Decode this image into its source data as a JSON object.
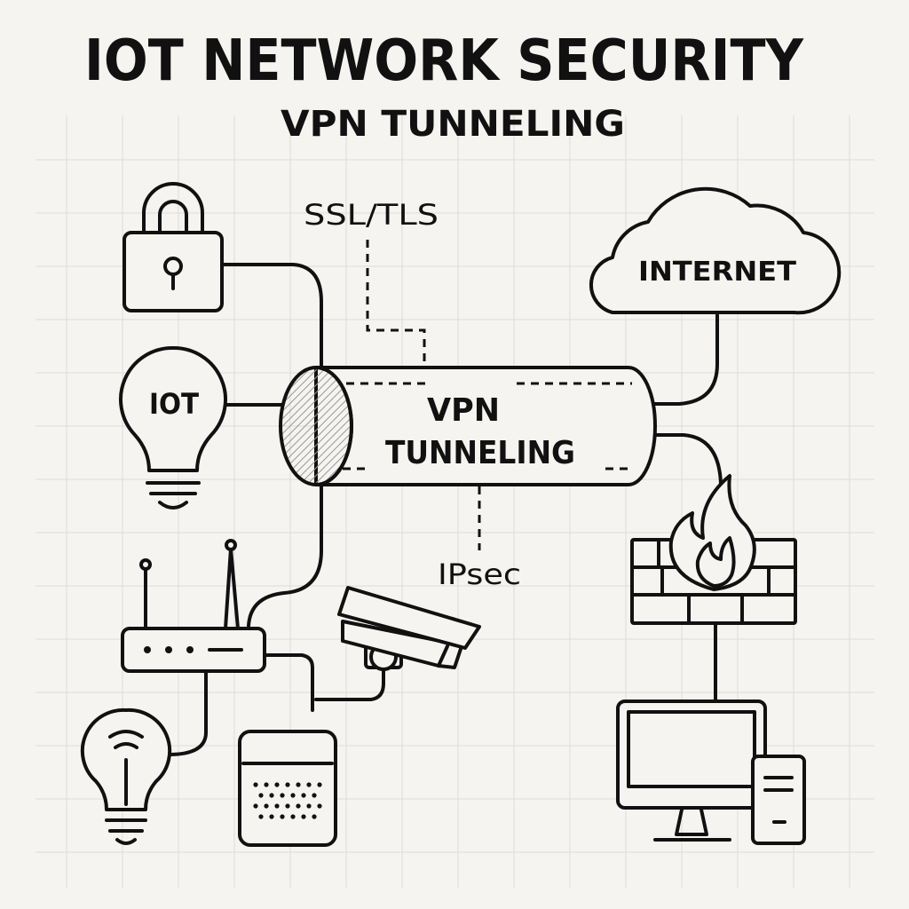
{
  "title": "IOT NETWORK SECURITY",
  "subtitle": "VPN TUNNELING",
  "labels": {
    "ssl_tls": "SSL/TLS",
    "internet": "INTERNET",
    "iot_bulb": "IOT",
    "tunnel_line1": "VPN",
    "tunnel_line2": "TUNNELING",
    "ipsec": "IPsec"
  },
  "colors": {
    "ink": "#111111",
    "paper": "#f5f4f0",
    "grid": "#dcdcdc"
  },
  "icons": [
    "padlock-icon",
    "iot-bulb-icon",
    "cloud-icon",
    "router-icon",
    "camera-icon",
    "smart-bulb-icon",
    "smart-speaker-icon",
    "firewall-icon",
    "desktop-computer-icon"
  ]
}
